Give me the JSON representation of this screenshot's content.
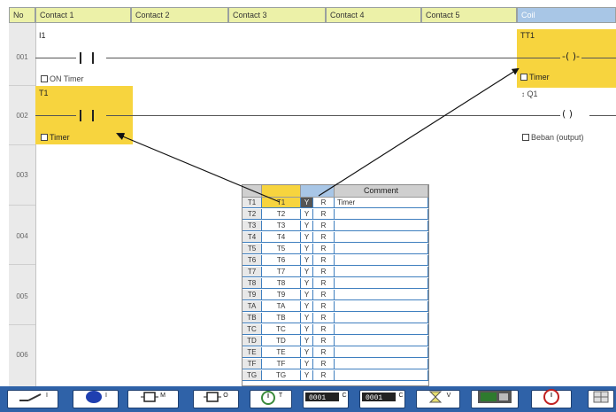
{
  "header": {
    "no": "No",
    "contacts": [
      "Contact 1",
      "Contact 2",
      "Contact 3",
      "Contact 4",
      "Contact 5"
    ],
    "coil": "Coil"
  },
  "rows": [
    "001",
    "002",
    "003",
    "004",
    "005",
    "006"
  ],
  "rung1": {
    "contact_tag": "I1",
    "contact_desc": "ON Timer",
    "coil_tag": "TT1",
    "coil_desc": "Timer",
    "coil_symbol": "-( )-"
  },
  "rung2": {
    "contact_tag": "T1",
    "contact_desc": "Timer",
    "contact_symbol": "-| |-",
    "coil_desc": "Beban (output)",
    "coil_symbol": "( )",
    "coil_tag": "Q1"
  },
  "popup": {
    "comment_header": "Comment",
    "rows": [
      {
        "num": "T1",
        "tag": "T1",
        "type": "Y",
        "flag": "R",
        "comment": "Timer",
        "selected": true
      },
      {
        "num": "T2",
        "tag": "T2",
        "type": "Y",
        "flag": "R",
        "comment": ""
      },
      {
        "num": "T3",
        "tag": "T3",
        "type": "Y",
        "flag": "R",
        "comment": ""
      },
      {
        "num": "T4",
        "tag": "T4",
        "type": "Y",
        "flag": "R",
        "comment": ""
      },
      {
        "num": "T5",
        "tag": "T5",
        "type": "Y",
        "flag": "R",
        "comment": ""
      },
      {
        "num": "T6",
        "tag": "T6",
        "type": "Y",
        "flag": "R",
        "comment": ""
      },
      {
        "num": "T7",
        "tag": "T7",
        "type": "Y",
        "flag": "R",
        "comment": ""
      },
      {
        "num": "T8",
        "tag": "T8",
        "type": "Y",
        "flag": "R",
        "comment": ""
      },
      {
        "num": "T9",
        "tag": "T9",
        "type": "Y",
        "flag": "R",
        "comment": ""
      },
      {
        "num": "TA",
        "tag": "TA",
        "type": "Y",
        "flag": "R",
        "comment": ""
      },
      {
        "num": "TB",
        "tag": "TB",
        "type": "Y",
        "flag": "R",
        "comment": ""
      },
      {
        "num": "TC",
        "tag": "TC",
        "type": "Y",
        "flag": "R",
        "comment": ""
      },
      {
        "num": "TD",
        "tag": "TD",
        "type": "Y",
        "flag": "R",
        "comment": ""
      },
      {
        "num": "TE",
        "tag": "TE",
        "type": "Y",
        "flag": "R",
        "comment": ""
      },
      {
        "num": "TF",
        "tag": "TF",
        "type": "Y",
        "flag": "R",
        "comment": ""
      },
      {
        "num": "TG",
        "tag": "TG",
        "type": "Y",
        "flag": "R",
        "comment": ""
      }
    ]
  },
  "toolbar": {
    "items": [
      {
        "icon": "switch-icon",
        "sup": "I"
      },
      {
        "icon": "blue-circle-icon",
        "sup": "I"
      },
      {
        "icon": "memory-block-icon",
        "sup": "M"
      },
      {
        "icon": "output-block-icon",
        "sup": "O"
      },
      {
        "icon": "timer-icon",
        "sup": "T"
      },
      {
        "icon": "counter-icon",
        "sup": "C"
      },
      {
        "icon": "counter-icon-2",
        "sup": "C"
      },
      {
        "icon": "hourglass-icon",
        "sup": "V"
      },
      {
        "icon": "display-icon",
        "sup": ""
      },
      {
        "icon": "clock-icon",
        "sup": ""
      },
      {
        "icon": "grid-icon",
        "sup": ""
      }
    ]
  },
  "colors": {
    "highlight": "#f7d43e",
    "header": "#ecf1a8",
    "coil_header": "#a8c6e6",
    "toolbar": "#2f62a8",
    "popup_grid": "#3f7fbf"
  }
}
